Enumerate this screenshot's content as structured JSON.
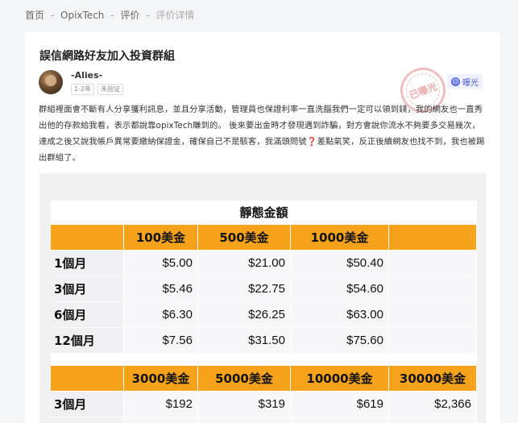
{
  "breadcrumb": {
    "items": [
      "首页",
      "OpixTech",
      "评价"
    ],
    "current": "评价详情",
    "separator": "-"
  },
  "post": {
    "title": "誤信網路好友加入投資群組",
    "author": "-Alies-",
    "tags": [
      "1-2年",
      "未验证"
    ],
    "stamp_text": "已曝光",
    "expose_label": "曝光",
    "expose_icon": "sad-face-icon",
    "body": "群組裡面會不斷有人分享獲利訊息，並且分享活動，管理員也保證利率一直洗腦我們一定可以領到錢，我的網友也一直秀出他的存款給我看，表示都說靠opixTech賺到的。 後來要出金時才發現遇到詐騙，對方會說你流水不夠要多交易幾次，達成之後又說我帳戶異常要繳納保證金，確保自己不是駭客，我滿頭問號❓差點氣笑，反正後續網友也找不到，我也被踢出群組了。"
  },
  "image_table": {
    "title": "靜態金額",
    "table1": {
      "headers": [
        "",
        "100美金",
        "500美金",
        "1000美金",
        ""
      ],
      "rows": [
        [
          "1個月",
          "$5.00",
          "$21.00",
          "$50.40",
          ""
        ],
        [
          "3個月",
          "$5.46",
          "$22.75",
          "$54.60",
          ""
        ],
        [
          "6個月",
          "$6.30",
          "$26.25",
          "$63.00",
          ""
        ],
        [
          "12個月",
          "$7.56",
          "$31.50",
          "$75.60",
          ""
        ]
      ]
    },
    "table2": {
      "headers": [
        "",
        "3000美金",
        "5000美金",
        "10000美金",
        "30000美金"
      ],
      "rows": [
        [
          "3個月",
          "$192",
          "$319",
          "$619",
          "$2,366"
        ],
        [
          "",
          "",
          "",
          "",
          ""
        ]
      ]
    }
  },
  "colors": {
    "accent_orange": "#f6a31b",
    "expose_blue": "#4a5bd6",
    "stamp_red": "#d54646"
  }
}
